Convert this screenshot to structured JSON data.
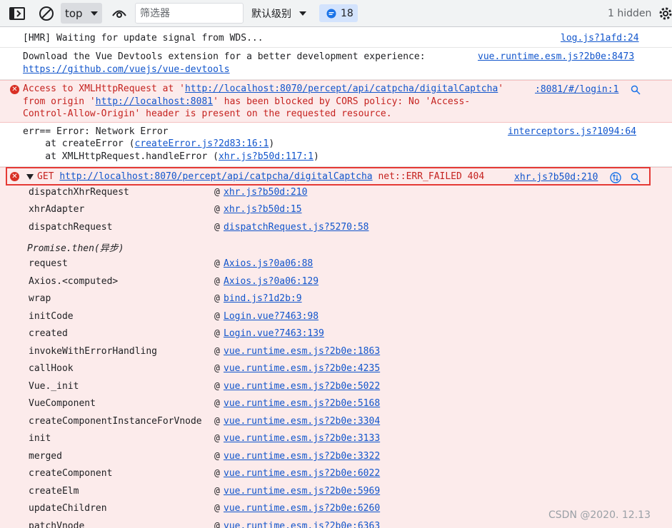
{
  "toolbar": {
    "context": "top",
    "filter_placeholder": "筛选器",
    "levels": "默认级别",
    "issues_count": "18",
    "hidden": "1 hidden"
  },
  "messages": [
    {
      "text": "[HMR] Waiting for update signal from WDS...",
      "source": "log.js?1afd:24"
    },
    {
      "text": "Download the Vue Devtools extension for a better development experience:",
      "link": "https://github.com/vuejs/vue-devtools",
      "source": "vue.runtime.esm.js?2b0e:8473"
    },
    {
      "line1a": "Access to XMLHttpRequest at '",
      "url1": "http://localhost:8070/percept/api/catpcha/digitalCaptcha",
      "line1b": "'",
      "line2a": "from origin '",
      "url2": "http://localhost:8081",
      "line2b": "' has been blocked by CORS policy: No 'Access-",
      "line3": "Control-Allow-Origin' header is present on the requested resource.",
      "source": ":8081/#/login:1"
    },
    {
      "line1": "err== Error: Network Error",
      "line2a": "    at createError (",
      "line2link": "createError.js?2d83:16:1",
      "line2b": ")",
      "line3a": "    at XMLHttpRequest.handleError (",
      "line3link": "xhr.js?b50d:117:1",
      "line3b": ")",
      "source": "interceptors.js?1094:64"
    },
    {
      "method": "GET",
      "url": "http://localhost:8070/percept/api/catpcha/digitalCaptcha",
      "status": "net::ERR_FAILED 404",
      "source": "xhr.js?b50d:210"
    }
  ],
  "stack": [
    {
      "fn": "dispatchXhrRequest",
      "loc": "xhr.js?b50d:210"
    },
    {
      "fn": "xhrAdapter",
      "loc": "xhr.js?b50d:15"
    },
    {
      "fn": "dispatchRequest",
      "loc": "dispatchRequest.js?5270:58"
    },
    {
      "async": "Promise.then(异步)"
    },
    {
      "fn": "request",
      "loc": "Axios.js?0a06:88"
    },
    {
      "fn": "Axios.<computed>",
      "loc": "Axios.js?0a06:129"
    },
    {
      "fn": "wrap",
      "loc": "bind.js?1d2b:9"
    },
    {
      "fn": "initCode",
      "loc": "Login.vue?7463:98"
    },
    {
      "fn": "created",
      "loc": "Login.vue?7463:139"
    },
    {
      "fn": "invokeWithErrorHandling",
      "loc": "vue.runtime.esm.js?2b0e:1863"
    },
    {
      "fn": "callHook",
      "loc": "vue.runtime.esm.js?2b0e:4235"
    },
    {
      "fn": "Vue._init",
      "loc": "vue.runtime.esm.js?2b0e:5022"
    },
    {
      "fn": "VueComponent",
      "loc": "vue.runtime.esm.js?2b0e:5168"
    },
    {
      "fn": "createComponentInstanceForVnode",
      "loc": "vue.runtime.esm.js?2b0e:3304"
    },
    {
      "fn": "init",
      "loc": "vue.runtime.esm.js?2b0e:3133"
    },
    {
      "fn": "merged",
      "loc": "vue.runtime.esm.js?2b0e:3322"
    },
    {
      "fn": "createComponent",
      "loc": "vue.runtime.esm.js?2b0e:6022"
    },
    {
      "fn": "createElm",
      "loc": "vue.runtime.esm.js?2b0e:5969"
    },
    {
      "fn": "updateChildren",
      "loc": "vue.runtime.esm.js?2b0e:6260"
    },
    {
      "fn": "patchVnode",
      "loc": "vue.runtime.esm.js?2b0e:6363"
    }
  ],
  "at_symbol": "@",
  "watermark": "CSDN @2020. 12.13"
}
